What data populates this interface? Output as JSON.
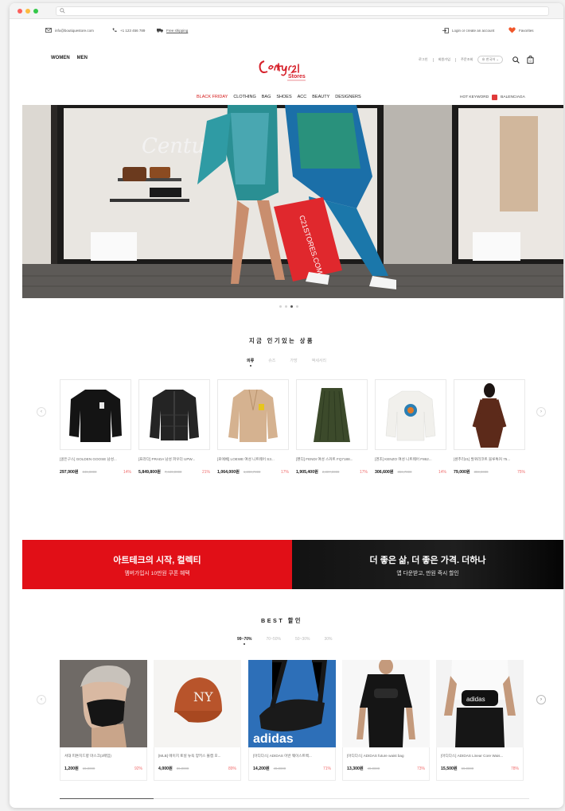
{
  "topbar": {
    "email": "info@boutiquestore.com",
    "phone": "+1 123 456 789",
    "shipping": "Free shipping",
    "login": "Login or create an account",
    "favorites": "Favorites"
  },
  "logo": {
    "text": "Century21",
    "sub": "Stores"
  },
  "gender_nav": [
    "WOMEN",
    "MEN"
  ],
  "utility": {
    "links": [
      "로그인",
      "회원가입",
      "주문조회"
    ],
    "language": "한국어"
  },
  "main_nav": [
    "BLACK FRIDAY",
    "CLOTHING",
    "BAG",
    "SHOES",
    "ACC",
    "BEAUTY",
    "DESIGNERS"
  ],
  "hot_keyword": {
    "label": "HOT KEYWORD",
    "value": "BALENCIAGA"
  },
  "hero": {
    "bag_text": "C21STORES.COM",
    "window_text": "Century21"
  },
  "section1": {
    "title": "지금 인기있는 상품",
    "tabs": [
      "의류",
      "슈즈",
      "가방",
      "액세서리"
    ]
  },
  "products": [
    {
      "name": "[골든구스] GOLDEN GOOSE 남성...",
      "price": "297,900원",
      "orig": "346,0000",
      "off": "14%"
    },
    {
      "name": "[프라다] PRADA 남성 파우더 UPW...",
      "price": "5,849,800원",
      "orig": "7,449,0000",
      "off": "21%"
    },
    {
      "name": "[로에베] LOEWE 여성 니트웨어 S3...",
      "price": "1,064,000원",
      "orig": "1,280,7000",
      "off": "17%"
    },
    {
      "name": "[펜디] FENDI 여성 스커트 FQ7188...",
      "price": "1,905,400원",
      "orig": "2,307,0000",
      "off": "17%"
    },
    {
      "name": "[겐조] KENZO 여성 니트웨어 F862...",
      "price": "306,600원",
      "orig": "356,7000",
      "off": "14%"
    },
    {
      "name": "[센추리21] 발퀴리코트 블루톡커 75...",
      "price": "79,000원",
      "orig": "359,0000",
      "off": "75%"
    }
  ],
  "banner": {
    "left_title": "아트테크의 시작, 컬렉티",
    "left_sub": "멤버가입시 10만원 쿠폰 혜택",
    "right_title": "더 좋은 삶, 더 좋은 가격. 더하나",
    "right_sub": "앱 다운받고, 만원 즉시 할인"
  },
  "section2": {
    "title": "BEST 할인",
    "tabs": [
      "99~70%",
      "70~50%",
      "50~30%",
      "30%"
    ]
  },
  "best": [
    {
      "name": "서대 피톤치드향 마스크(3매입)",
      "price": "1,200원",
      "orig": "15,0000",
      "off": "92%"
    },
    {
      "name": "[MLB] 에이치 토널 뉴욕 양키스 볼캡 모...",
      "price": "4,000원",
      "orig": "36,0000",
      "off": "89%"
    },
    {
      "name": "[아디다스] ADIDAS 어반 웨이스트백...",
      "price": "14,200원",
      "orig": "49,0000",
      "off": "71%"
    },
    {
      "name": "[아디다스] ADIDAS future waist bag",
      "price": "13,300원",
      "orig": "49,0000",
      "off": "73%"
    },
    {
      "name": "[아디다스] ADIDAS Linear Core Wais...",
      "price": "15,500원",
      "orig": "69,0000",
      "off": "78%"
    }
  ],
  "colors": {
    "accent": "#e10f17",
    "sale": "#f06e6e"
  }
}
